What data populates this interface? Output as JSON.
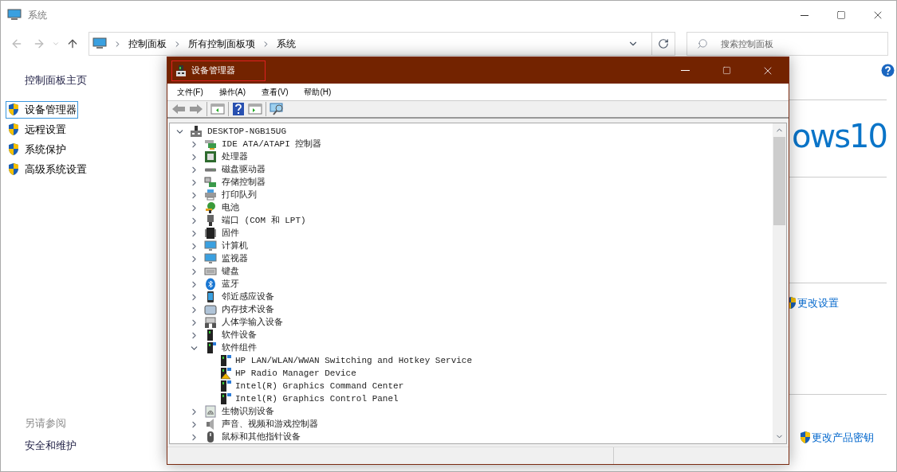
{
  "window": {
    "title": "系统"
  },
  "address_bar": {
    "path": [
      "控制面板",
      "所有控制面板项",
      "系统"
    ]
  },
  "search": {
    "placeholder": "搜索控制面板"
  },
  "sidebar": {
    "home": "控制面板主页",
    "items": [
      {
        "label": "设备管理器",
        "selected": true
      },
      {
        "label": "远程设置",
        "selected": false
      },
      {
        "label": "系统保护",
        "selected": false
      },
      {
        "label": "高级系统设置",
        "selected": false
      }
    ],
    "see_also": {
      "heading": "另请参阅",
      "links": [
        "安全和维护"
      ]
    }
  },
  "content": {
    "logo_text": "ows10",
    "change_settings": "更改设置",
    "change_key": "更改产品密钥"
  },
  "device_manager": {
    "title": "设备管理器",
    "menu": [
      "文件(F)",
      "操作(A)",
      "查看(V)",
      "帮助(H)"
    ],
    "tree": {
      "label": "DESKTOP-NGB15UG",
      "expanded": true,
      "children": [
        {
          "label": "IDE ATA/ATAPI 控制器",
          "expanded": false
        },
        {
          "label": "处理器",
          "expanded": false
        },
        {
          "label": "磁盘驱动器",
          "expanded": false
        },
        {
          "label": "存储控制器",
          "expanded": false
        },
        {
          "label": "打印队列",
          "expanded": false
        },
        {
          "label": "电池",
          "expanded": false
        },
        {
          "label": "端口 (COM 和 LPT)",
          "expanded": false
        },
        {
          "label": "固件",
          "expanded": false
        },
        {
          "label": "计算机",
          "expanded": false
        },
        {
          "label": "监视器",
          "expanded": false
        },
        {
          "label": "键盘",
          "expanded": false
        },
        {
          "label": "蓝牙",
          "expanded": false
        },
        {
          "label": "邻近感应设备",
          "expanded": false
        },
        {
          "label": "内存技术设备",
          "expanded": false
        },
        {
          "label": "人体学输入设备",
          "expanded": false
        },
        {
          "label": "软件设备",
          "expanded": false
        },
        {
          "label": "软件组件",
          "expanded": true,
          "children": [
            {
              "label": "HP LAN/WLAN/WWAN Switching and Hotkey Service",
              "warning": false
            },
            {
              "label": "HP Radio Manager Device",
              "warning": true
            },
            {
              "label": "Intel(R) Graphics Command Center",
              "warning": false
            },
            {
              "label": "Intel(R) Graphics Control Panel",
              "warning": false
            }
          ]
        },
        {
          "label": "生物识别设备",
          "expanded": false
        },
        {
          "label": "声音、视频和游戏控制器",
          "expanded": false
        },
        {
          "label": "鼠标和其他指针设备",
          "expanded": false
        }
      ]
    }
  }
}
